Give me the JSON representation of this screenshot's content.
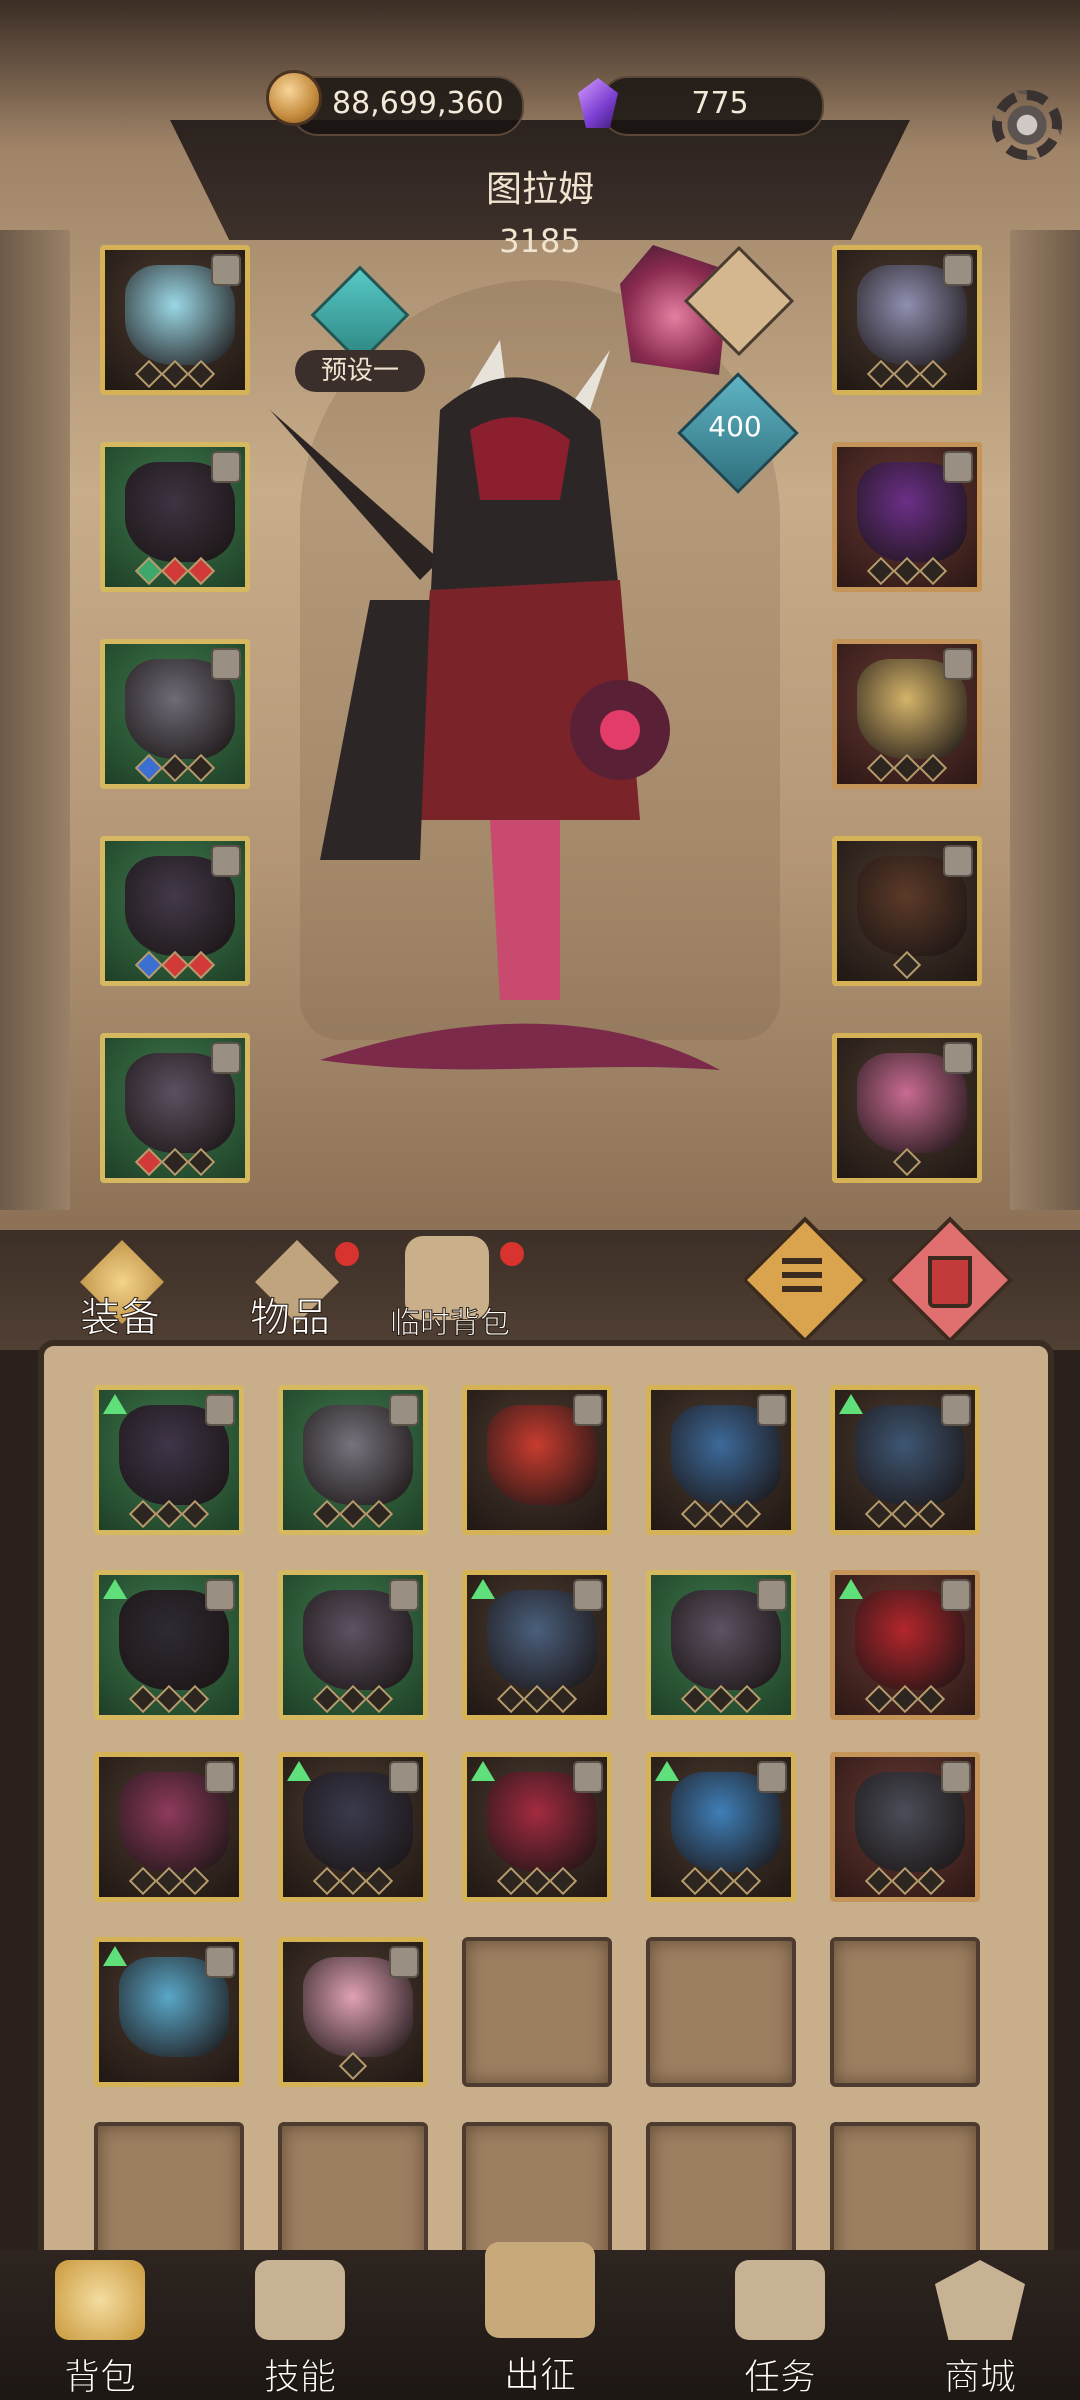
{
  "currency": {
    "gold": "88,699,360",
    "gems": "775"
  },
  "hero": {
    "name": "图拉姆",
    "power": "3185",
    "preset_label": "预设一",
    "artifact_level": "400"
  },
  "tabs": [
    {
      "label": "装备",
      "active": true,
      "badge": false
    },
    {
      "label": "物品",
      "active": false,
      "badge": true
    },
    {
      "label": "临时背包",
      "active": false,
      "badge": true
    }
  ],
  "left_slots": [
    {
      "name": "helmet",
      "rarity": "gold",
      "color": "#9bd8e6",
      "gems": [
        "",
        "",
        ""
      ]
    },
    {
      "name": "armor",
      "rarity": "green",
      "color": "#3e3342",
      "gems": [
        "g",
        "r",
        "r"
      ]
    },
    {
      "name": "gauntlet",
      "rarity": "green",
      "color": "#6f6b77",
      "gems": [
        "b",
        "",
        ""
      ]
    },
    {
      "name": "skirt",
      "rarity": "green",
      "color": "#43394a",
      "gems": [
        "b",
        "r",
        "r"
      ]
    },
    {
      "name": "boots",
      "rarity": "green",
      "color": "#5c5060",
      "gems": [
        "r",
        "",
        ""
      ]
    }
  ],
  "right_slots": [
    {
      "name": "necklace",
      "rarity": "gold",
      "color": "#8f8fb0",
      "gems": [
        "",
        "",
        ""
      ]
    },
    {
      "name": "ring",
      "rarity": "red",
      "color": "#6b2f88",
      "gems": [
        "",
        "",
        ""
      ]
    },
    {
      "name": "emblem-armlet",
      "rarity": "red",
      "color": "#d4b46a",
      "gems": [
        "",
        "",
        ""
      ]
    },
    {
      "name": "bow",
      "rarity": "gold",
      "color": "#5c3a28",
      "gems": [
        ""
      ]
    },
    {
      "name": "cursed-flower",
      "rarity": "gold",
      "color": "#c86b92",
      "gems": [
        ""
      ]
    }
  ],
  "inventory": [
    {
      "name": "skirt",
      "rarity": "green",
      "upgrade": true,
      "color": "#3f3549",
      "gems": [
        "",
        "",
        ""
      ]
    },
    {
      "name": "gauntlet",
      "rarity": "green",
      "upgrade": false,
      "color": "#77737d",
      "gems": [
        "",
        "",
        ""
      ]
    },
    {
      "name": "crimson-gem-amulet",
      "rarity": "gold",
      "upgrade": false,
      "color": "#c83c2f",
      "gems": []
    },
    {
      "name": "robe",
      "rarity": "gold",
      "upgrade": false,
      "color": "#3d6a9a",
      "gems": [
        "",
        "",
        ""
      ]
    },
    {
      "name": "steel-boots",
      "rarity": "gold",
      "upgrade": true,
      "color": "#3e5673",
      "gems": [
        "",
        "",
        ""
      ]
    },
    {
      "name": "dark-hood",
      "rarity": "green",
      "upgrade": true,
      "color": "#2f2a33",
      "gems": [
        "",
        "",
        ""
      ]
    },
    {
      "name": "boots",
      "rarity": "green",
      "upgrade": false,
      "color": "#5d5262",
      "gems": [
        "",
        "",
        ""
      ]
    },
    {
      "name": "steel-boots",
      "rarity": "gold",
      "upgrade": true,
      "color": "#4a5f7c",
      "gems": [
        "",
        "",
        ""
      ]
    },
    {
      "name": "boots",
      "rarity": "green",
      "upgrade": false,
      "color": "#5d5262",
      "gems": [
        "",
        "",
        ""
      ]
    },
    {
      "name": "ruby-helm",
      "rarity": "red",
      "upgrade": true,
      "color": "#b3262c",
      "gems": [
        "",
        "",
        ""
      ]
    },
    {
      "name": "dress",
      "rarity": "gold",
      "upgrade": false,
      "color": "#8e3a5c",
      "gems": [
        "",
        "",
        ""
      ]
    },
    {
      "name": "cloak",
      "rarity": "gold",
      "upgrade": true,
      "color": "#3a3a4d",
      "gems": [
        "",
        "",
        ""
      ]
    },
    {
      "name": "crimson-greaves",
      "rarity": "gold",
      "upgrade": true,
      "color": "#a32b40",
      "gems": [
        "",
        "",
        ""
      ]
    },
    {
      "name": "frost-gauntlet",
      "rarity": "gold",
      "upgrade": true,
      "color": "#3f7fb8",
      "gems": [
        "",
        "",
        ""
      ]
    },
    {
      "name": "runic-ring",
      "rarity": "red",
      "upgrade": false,
      "color": "#4a4d58",
      "gems": [
        "",
        "",
        ""
      ]
    },
    {
      "name": "blue-scythe",
      "rarity": "gold",
      "upgrade": true,
      "color": "#5aa7c8",
      "gems": []
    },
    {
      "name": "pink-flame-flower",
      "rarity": "gold",
      "upgrade": false,
      "color": "#e0a2b5",
      "gems": [
        ""
      ]
    }
  ],
  "empty_slot_count": 8,
  "bottom_nav": [
    {
      "label": "背包",
      "icon": "backpack-icon",
      "active": true
    },
    {
      "label": "技能",
      "icon": "skill-book-icon",
      "active": false
    },
    {
      "label": "出征",
      "icon": "battle-scroll-icon",
      "active": false
    },
    {
      "label": "任务",
      "icon": "quest-scroll-icon",
      "active": false
    },
    {
      "label": "商城",
      "icon": "shop-icon",
      "active": false
    }
  ]
}
